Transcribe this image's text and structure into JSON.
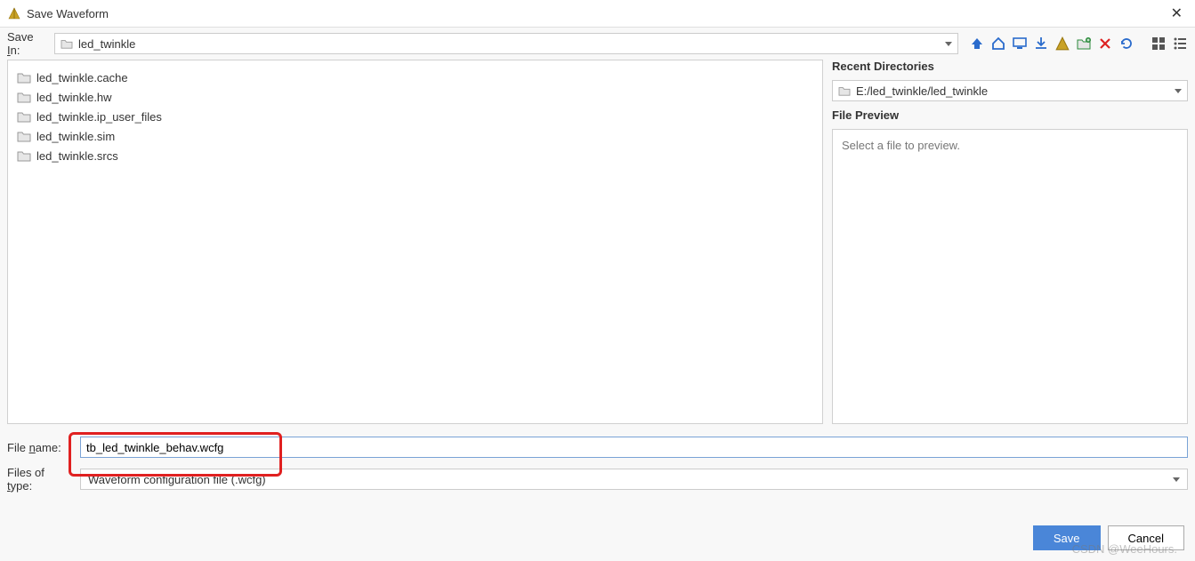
{
  "title": "Save Waveform",
  "save_in_label": "Save In:",
  "save_in_value": "led_twinkle",
  "files": [
    "led_twinkle.cache",
    "led_twinkle.hw",
    "led_twinkle.ip_user_files",
    "led_twinkle.sim",
    "led_twinkle.srcs"
  ],
  "right": {
    "recent_title": "Recent Directories",
    "recent_value": "E:/led_twinkle/led_twinkle",
    "preview_title": "File Preview",
    "preview_placeholder": "Select a file to preview."
  },
  "form": {
    "name_label": "File name:",
    "name_value": "tb_led_twinkle_behav.wcfg",
    "type_label": "Files of type:",
    "type_value": "Waveform configuration file (.wcfg)"
  },
  "buttons": {
    "save": "Save",
    "cancel": "Cancel"
  },
  "watermark": "CSDN @WeeHours."
}
